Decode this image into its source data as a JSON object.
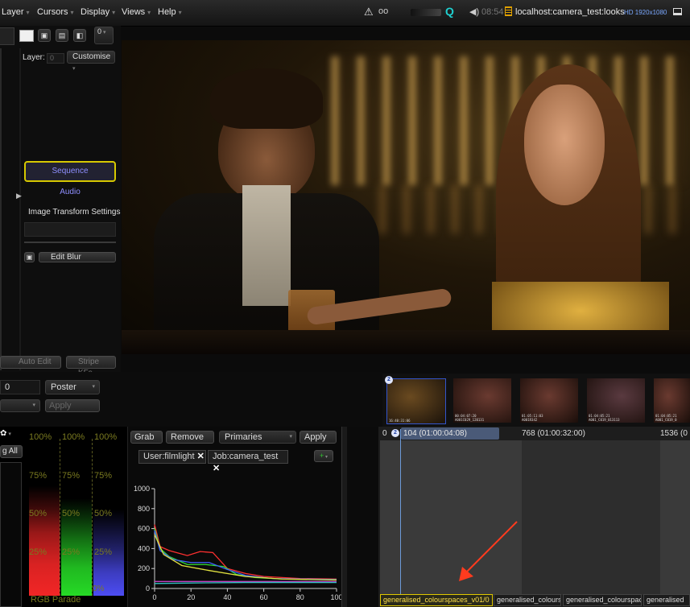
{
  "menubar": {
    "items": [
      "Layer",
      "Cursors",
      "Display",
      "Views",
      "Help"
    ],
    "clock": "08:54",
    "location": "localhost:camera_test:looks",
    "resolution": "HD 1920x1080"
  },
  "left_panel": {
    "number_field": "0",
    "layer_label": "Layer:",
    "layer_value": "0",
    "customise": "Customise",
    "sequence": "Sequence",
    "audio": "Audio",
    "image_transform": "Image Transform Settings",
    "edit_blur": "Edit Blur",
    "auto_edit": "Auto Edit",
    "stripe_kfs": "Stripe KFs"
  },
  "mid_controls": {
    "value_field": "0",
    "poster": "Poster",
    "apply": "Apply"
  },
  "scopes": {
    "all_label": "g All",
    "labels_100": [
      "100%",
      "100%",
      "100%"
    ],
    "labels_75": [
      "75%",
      "75%",
      "75%"
    ],
    "labels_50": [
      "50%",
      "50%",
      "50%"
    ],
    "labels_25": [
      "25%",
      "25%",
      "25%"
    ],
    "labels_0": [
      "0%"
    ],
    "caption": "RGB Parade"
  },
  "grade_panel": {
    "grab": "Grab",
    "remove": "Remove",
    "primaries": "Primaries",
    "apply": "Apply",
    "tab_user": "User:filmlight",
    "tab_job": "Job:camera_test"
  },
  "chart_data": {
    "type": "line",
    "xlim": [
      0,
      100
    ],
    "ylim": [
      0,
      1000
    ],
    "x_ticks": [
      "0",
      "20",
      "40",
      "60",
      "80",
      "100"
    ],
    "y_ticks": [
      "0",
      "200",
      "400",
      "600",
      "800",
      "1000"
    ],
    "series": [
      {
        "color": "#ff3030",
        "points": [
          [
            0,
            640
          ],
          [
            3,
            420
          ],
          [
            8,
            380
          ],
          [
            18,
            330
          ],
          [
            25,
            370
          ],
          [
            32,
            360
          ],
          [
            40,
            200
          ],
          [
            50,
            150
          ],
          [
            60,
            120
          ],
          [
            80,
            100
          ],
          [
            100,
            95
          ]
        ]
      },
      {
        "color": "#30e030",
        "points": [
          [
            0,
            600
          ],
          [
            3,
            400
          ],
          [
            8,
            320
          ],
          [
            18,
            240
          ],
          [
            28,
            240
          ],
          [
            38,
            220
          ],
          [
            45,
            140
          ],
          [
            55,
            110
          ],
          [
            70,
            95
          ],
          [
            100,
            90
          ]
        ]
      },
      {
        "color": "#4060ff",
        "points": [
          [
            0,
            580
          ],
          [
            3,
            380
          ],
          [
            10,
            290
          ],
          [
            20,
            260
          ],
          [
            30,
            260
          ],
          [
            40,
            190
          ],
          [
            50,
            130
          ],
          [
            65,
            100
          ],
          [
            80,
            95
          ],
          [
            100,
            90
          ]
        ]
      },
      {
        "color": "#e0e040",
        "points": [
          [
            0,
            540
          ],
          [
            5,
            340
          ],
          [
            15,
            230
          ],
          [
            30,
            180
          ],
          [
            50,
            120
          ],
          [
            70,
            95
          ],
          [
            100,
            85
          ]
        ]
      },
      {
        "color": "#c040c0",
        "points": [
          [
            0,
            70
          ],
          [
            20,
            70
          ],
          [
            50,
            70
          ],
          [
            80,
            70
          ],
          [
            100,
            70
          ]
        ]
      },
      {
        "color": "#30c0c0",
        "points": [
          [
            0,
            50
          ],
          [
            20,
            55
          ],
          [
            50,
            60
          ],
          [
            80,
            60
          ],
          [
            100,
            60
          ]
        ]
      }
    ]
  },
  "timeline": {
    "marker_0": "0",
    "badge": "2",
    "frame_current": "104 (01:00:04:08)",
    "frame_768": "768 (01:00:32:00)",
    "frame_1536": "1536 (0",
    "tabs": [
      "generalised_colourspaces_v01/0",
      "generalised_colours",
      "generalised_colourspac",
      "generalised"
    ],
    "thumb_badge": "2",
    "thumbs": [
      {
        "tc": "16:40:31:06"
      },
      {
        "tc": "00:04:07:20\nA001C029_120131"
      },
      {
        "tc": "01:05:11:03\nA001R342"
      },
      {
        "tc": "01:04:05:21\nA001_C019_013113"
      },
      {
        "tc": "01:04:05:21\nA001_C019_0"
      }
    ]
  },
  "colors": {
    "accent": "#ffd400",
    "selection_blue": "#6d9ad8",
    "sequence_text": "#8f8fff",
    "arrow": "#ff3b1e"
  }
}
